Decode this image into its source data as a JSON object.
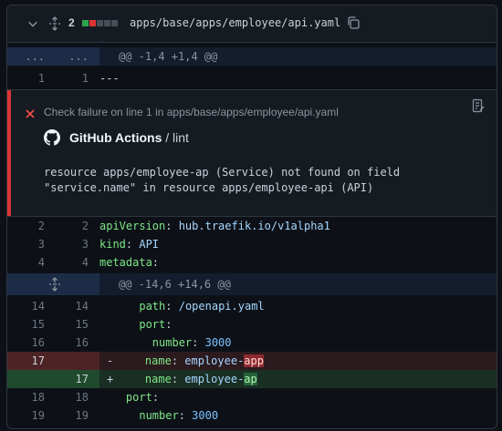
{
  "file": {
    "change_count": "2",
    "path": "apps/base/apps/employee/api.yaml",
    "blocks": [
      "#2da44e",
      "#da3633",
      "#6e7681",
      "#6e7681",
      "#6e7681"
    ]
  },
  "hunk1": {
    "ln_left": "...",
    "ln_right": "...",
    "header": "@@ -1,4 +1,4 @@"
  },
  "line1": {
    "left": "1",
    "right": "1",
    "text": "---"
  },
  "annotation": {
    "title": "Check failure on line 1 in apps/base/apps/employee/api.yaml",
    "app_name": "GitHub Actions",
    "separator": " / ",
    "job": "lint",
    "message_line1": "resource apps/employee-ap (Service) not found on field",
    "message_line2": "\"service.name\" in resource apps/employee-api (API)"
  },
  "block1": [
    {
      "left": "2",
      "right": "2",
      "key": "apiVersion",
      "sep": ": ",
      "val": "hub.traefik.io/v1alpha1"
    },
    {
      "left": "3",
      "right": "3",
      "key": "kind",
      "sep": ": ",
      "val": "API"
    },
    {
      "left": "4",
      "right": "4",
      "key": "metadata",
      "sep": ":",
      "val": ""
    }
  ],
  "hunk2": {
    "header": "@@ -14,6 +14,6 @@"
  },
  "block2": [
    {
      "left": "14",
      "right": "14",
      "indent": "      ",
      "key": "path",
      "sep": ": ",
      "val": "/openapi.yaml"
    },
    {
      "left": "15",
      "right": "15",
      "indent": "      ",
      "key": "port",
      "sep": ":",
      "val": ""
    },
    {
      "left": "16",
      "right": "16",
      "indent": "        ",
      "key": "number",
      "sep": ": ",
      "val": "3000"
    }
  ],
  "deleted": {
    "left": "17",
    "sign": "-",
    "indent": "    ",
    "key": "name",
    "sep": ": ",
    "val_pre": "employee-",
    "val_hl": "app"
  },
  "added": {
    "right": "17",
    "sign": "+",
    "indent": "    ",
    "key": "name",
    "sep": ": ",
    "val_pre": "employee-",
    "val_hl": "ap"
  },
  "block3": [
    {
      "left": "18",
      "right": "18",
      "indent": "    ",
      "key": "port",
      "sep": ":",
      "val": ""
    },
    {
      "left": "19",
      "right": "19",
      "indent": "      ",
      "key": "number",
      "sep": ": ",
      "val": "3000"
    }
  ]
}
